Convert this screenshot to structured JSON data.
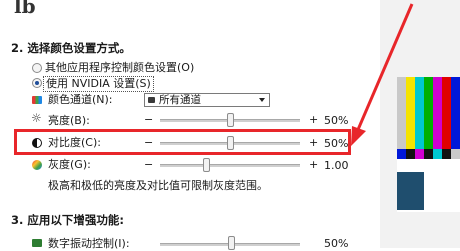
{
  "top_fragment": "lb",
  "section2": {
    "title": "2. 选择颜色设置方式。",
    "radio_other": "其他应用程序控制颜色设置(O)",
    "radio_nvidia": "使用 NVIDIA 设置(S)",
    "channel_label": "颜色通道(N):",
    "channel_value": "所有通道",
    "brightness": {
      "label": "亮度(B):",
      "minus": "−",
      "plus": "+",
      "value_text": "50%",
      "level": 0.5
    },
    "contrast": {
      "label": "对比度(C):",
      "minus": "−",
      "plus": "+",
      "value_text": "50%",
      "level": 0.5
    },
    "gamma": {
      "label": "灰度(G):",
      "minus": "−",
      "plus": "+",
      "value_text": "1.00",
      "level": 0.33
    },
    "note": "极高和极低的亮度及对比值可限制灰度范围。"
  },
  "section3": {
    "title": "3. 应用以下增强功能:",
    "vibrance_label": "数字振动控制(I):",
    "vibrance_value_text": "50%"
  },
  "colors": {
    "highlight_border": "#e8262a",
    "arrow": "#e8262a",
    "test_bars": [
      "#c9c9c9",
      "#f5e400",
      "#00c8d0",
      "#00b000",
      "#d000d0",
      "#e00000",
      "#0018d8"
    ]
  },
  "icons": {
    "brightness": "sun-icon",
    "contrast": "contrast-icon",
    "gamma": "color-wheel-icon",
    "channel": "color-channel-icon"
  }
}
